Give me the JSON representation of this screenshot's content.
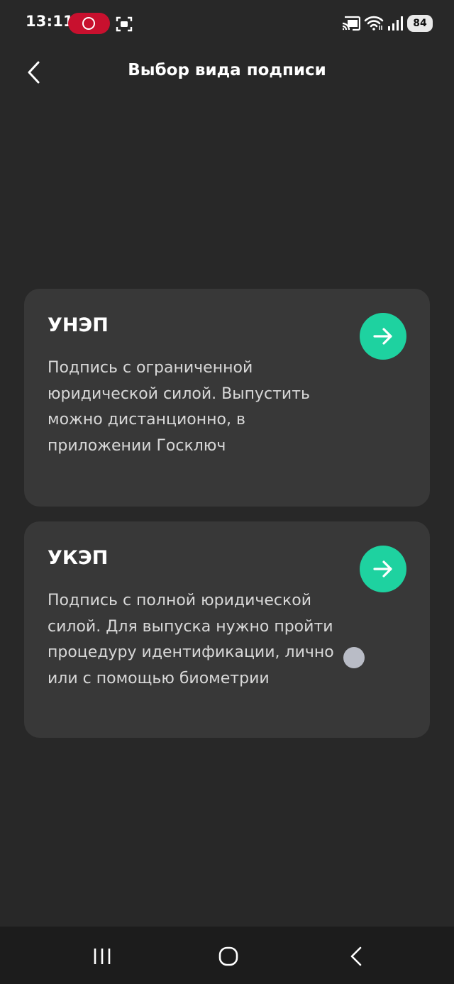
{
  "status_bar": {
    "time": "13:11",
    "battery": "84",
    "icons": [
      "record-icon",
      "screenshot-icon",
      "cast-icon",
      "wifi-icon",
      "signal-icon",
      "battery-icon"
    ]
  },
  "header": {
    "title": "Выбор вида подписи",
    "back_icon": "chevron-left-icon"
  },
  "cards": [
    {
      "title": "УНЭП",
      "description": "Подпись с ограниченной юридической силой. Выпустить можно дистанционно, в приложении Госключ",
      "action_icon": "arrow-right-icon"
    },
    {
      "title": "УКЭП",
      "description": "Подпись с полной юридической силой. Для выпуска нужно пройти процедуру идентификации, лично или с помощью биометрии",
      "action_icon": "arrow-right-icon"
    }
  ],
  "nav_bar": {
    "icons": [
      "recents-icon",
      "home-icon",
      "back-icon"
    ]
  },
  "colors": {
    "background": "#282828",
    "card": "#383838",
    "accent": "#1ed2a0",
    "record": "#c8102e"
  }
}
